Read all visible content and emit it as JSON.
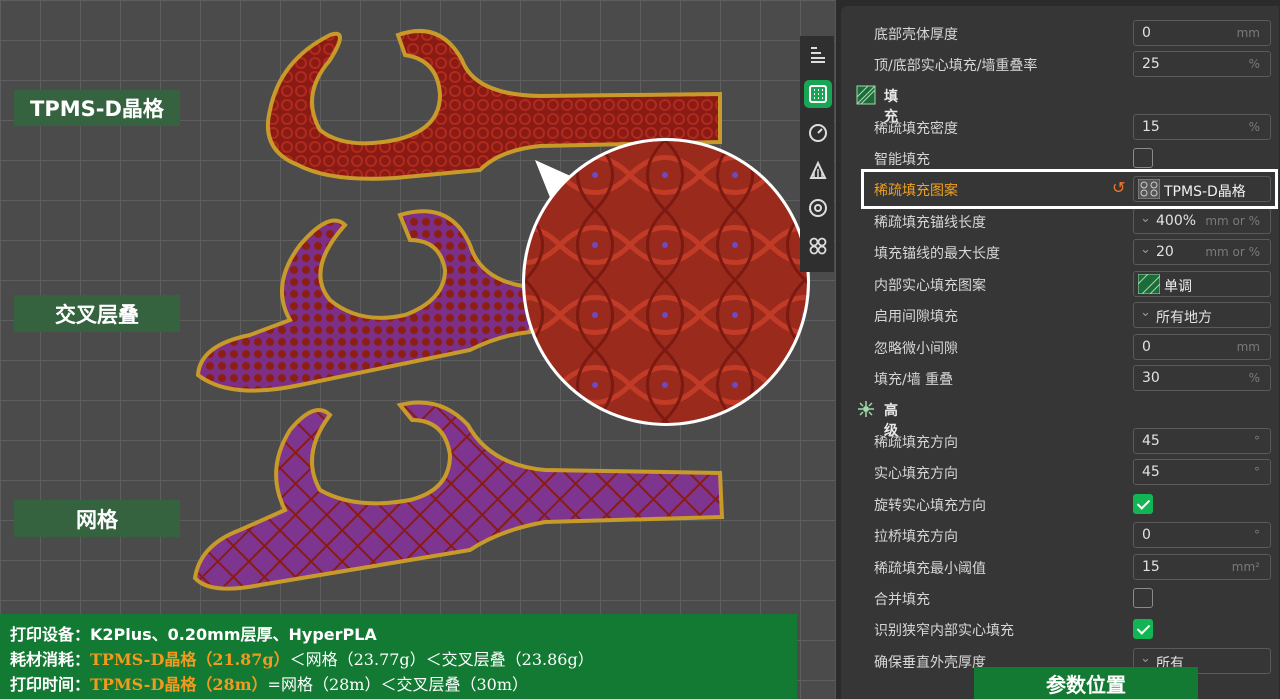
{
  "viewport": {
    "labels": [
      "TPMS-D晶格",
      "交叉层叠",
      "网格"
    ]
  },
  "summary": {
    "line1_prefix": "打印设备：",
    "line1_value": "K2Plus、0.20mm层厚、HyperPLA",
    "line2_prefix": "耗材消耗：",
    "line2_highlight": "TPMS-D晶格（21.87g）",
    "line2_rest": "＜网格（23.77g）＜交叉层叠（23.86g）",
    "line3_prefix": "打印时间：",
    "line3_highlight": "TPMS-D晶格（28m）",
    "line3_rest": "=网格（28m）＜交叉层叠（30m）"
  },
  "param_tag": "参数位置",
  "toolbar": {
    "icons": [
      "layers-icon",
      "infill-icon",
      "speed-icon",
      "support-icon",
      "filament-icon",
      "others-icon"
    ],
    "active": "infill-icon",
    "accent": "#18a554"
  },
  "settings": {
    "rows": [
      {
        "label": "底部壳体厚度",
        "value": "0",
        "unit": "mm",
        "type": "input"
      },
      {
        "label": "顶/底部实心填充/墙重叠率",
        "value": "25",
        "unit": "%",
        "type": "input"
      },
      {
        "label": "稀疏填充密度",
        "value": "15",
        "unit": "%",
        "type": "input"
      },
      {
        "label": "智能填充",
        "type": "checkbox",
        "checked": false
      },
      {
        "label": "稀疏填充图案",
        "value": "TPMS-D晶格",
        "type": "pattern"
      },
      {
        "label": "稀疏填充锚线长度",
        "value": "400%",
        "unit": "mm or %",
        "type": "select"
      },
      {
        "label": "填充锚线的最大长度",
        "value": "20",
        "unit": "mm or %",
        "type": "select"
      },
      {
        "label": "内部实心填充图案",
        "value": "单调",
        "type": "pattern"
      },
      {
        "label": "启用间隙填充",
        "value": "所有地方",
        "type": "select"
      },
      {
        "label": "忽略微小间隙",
        "value": "0",
        "unit": "mm",
        "type": "input"
      },
      {
        "label": "填充/墙 重叠",
        "value": "30",
        "unit": "%",
        "type": "input"
      },
      {
        "label": "稀疏填充方向",
        "value": "45",
        "unit": "°",
        "type": "input"
      },
      {
        "label": "实心填充方向",
        "value": "45",
        "unit": "°",
        "type": "input"
      },
      {
        "label": "旋转实心填充方向",
        "type": "checkbox",
        "checked": true
      },
      {
        "label": "拉桥填充方向",
        "value": "0",
        "unit": "°",
        "type": "input"
      },
      {
        "label": "稀疏填充最小阈值",
        "value": "15",
        "unit": "mm²",
        "type": "input"
      },
      {
        "label": "合并填充",
        "type": "checkbox",
        "checked": false
      },
      {
        "label": "识别狭窄内部实心填充",
        "type": "checkbox",
        "checked": true
      },
      {
        "label": "确保垂直外壳厚度",
        "value": "所有",
        "type": "select"
      }
    ],
    "sections": [
      "填充",
      "高级"
    ]
  }
}
